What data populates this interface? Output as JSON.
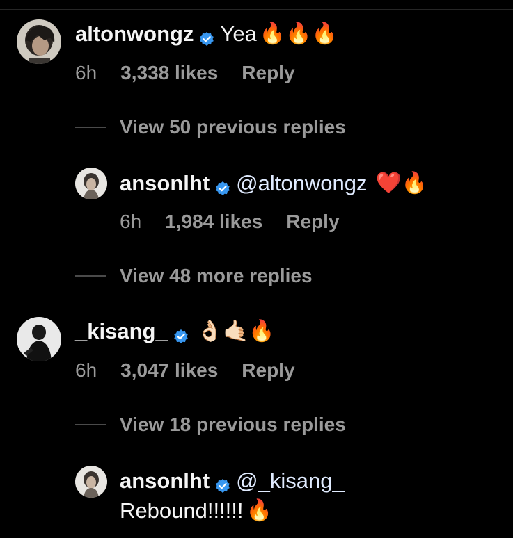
{
  "comments": [
    {
      "username": "altonwongz",
      "text": "Yea",
      "emojis": "🔥🔥🔥",
      "time": "6h",
      "likes": "3,338 likes",
      "reply_label": "Reply",
      "view_replies": "View 50 previous replies",
      "reply": {
        "username": "anson​lht",
        "mention": "@altonwongz",
        "emojis": "❤️🔥",
        "time": "6h",
        "likes": "1,984 likes",
        "reply_label": "Reply"
      }
    },
    {
      "view_more": "View 48 more replies"
    },
    {
      "username": "_kisang_",
      "emojis": "👌🏻🤙🏻🔥",
      "time": "6h",
      "likes": "3,047 likes",
      "reply_label": "Reply",
      "view_replies": "View 18 previous replies",
      "reply": {
        "username": "anson​lht",
        "mention": "@_kisang_",
        "text2": "Rebound!!!!!!",
        "emojis2": "🔥"
      }
    }
  ],
  "colors": {
    "background": "#000000",
    "verified": "#3897f0",
    "meta": "#9a9a9a"
  }
}
